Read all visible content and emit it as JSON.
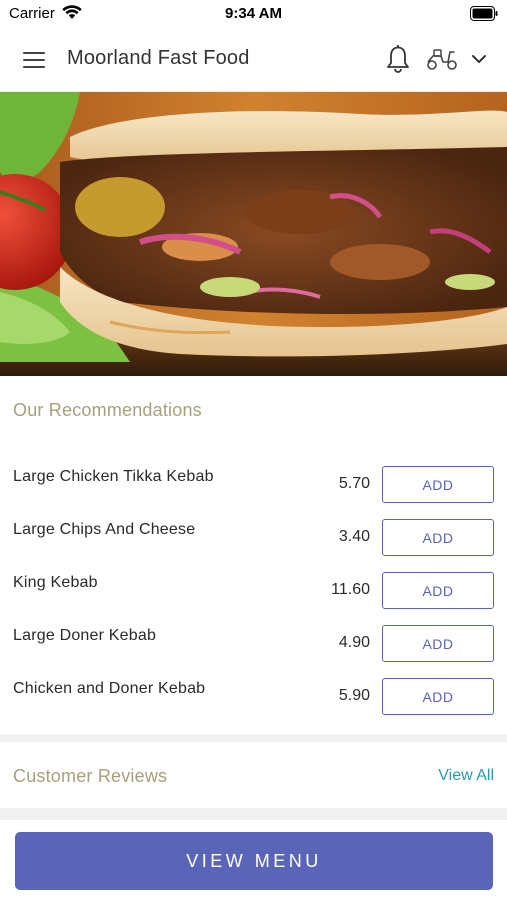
{
  "status_bar": {
    "carrier": "Carrier",
    "time": "9:34 AM"
  },
  "header": {
    "title": "Moorland Fast Food",
    "icons": [
      "hamburger-menu-icon",
      "bell-icon",
      "scooter-icon",
      "chevron-down-icon"
    ]
  },
  "hero": {
    "image": "kebab-photo"
  },
  "recommendations": {
    "title": "Our Recommendations",
    "items": [
      {
        "name": "Large Chicken Tikka Kebab",
        "price": "5.70",
        "button": "ADD"
      },
      {
        "name": "Large Chips And Cheese",
        "price": "3.40",
        "button": "ADD"
      },
      {
        "name": "King Kebab",
        "price": "11.60",
        "button": "ADD"
      },
      {
        "name": "Large Doner Kebab",
        "price": "4.90",
        "button": "ADD"
      },
      {
        "name": "Chicken and Doner Kebab",
        "price": "5.90",
        "button": "ADD"
      }
    ]
  },
  "reviews": {
    "title": "Customer Reviews",
    "link": "View All"
  },
  "footer": {
    "button": "VIEW MENU"
  },
  "colors": {
    "accent": "#5a65b8",
    "section_title": "#a7a07d",
    "link": "#2a9ab4"
  }
}
